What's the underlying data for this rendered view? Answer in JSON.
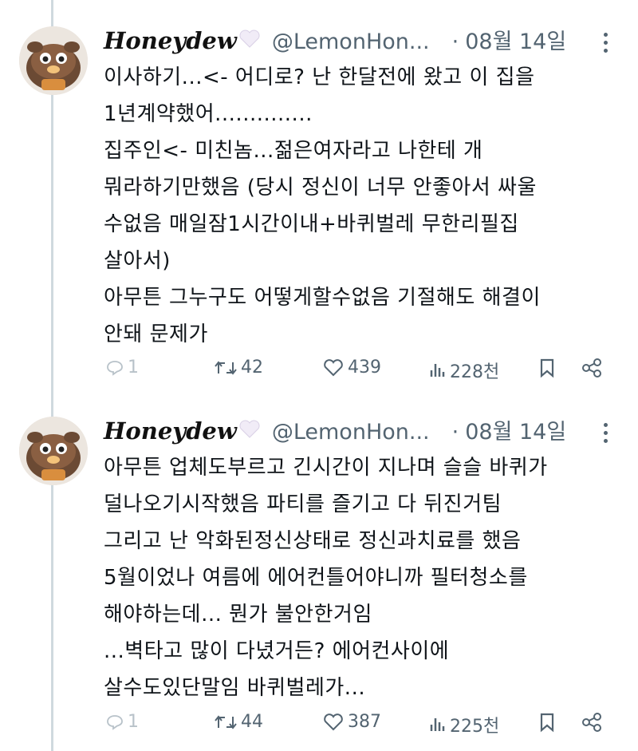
{
  "tweets": [
    {
      "author": {
        "name": "Honeydew",
        "badge_icon": "white-heart-icon",
        "handle": "@LemonHon...",
        "date": "08월 14일"
      },
      "lines": [
        "이사하기...<- 어디로? 난 한달전에 왔고 이 집을",
        "1년계약했어..............",
        "집주인<- 미친놈...젊은여자라고 나한테 개",
        "뭐라하기만했음 (당시 정신이 너무 안좋아서 싸울",
        "수없음 매일잠1시간이내+바퀴벌레 무한리필집",
        "살아서)",
        "아무튼 그누구도 어떻게할수없음 기절해도 해결이",
        "안돼 문제가"
      ],
      "stats": {
        "replies": "1",
        "retweets": "42",
        "likes": "439",
        "views": "228천"
      }
    },
    {
      "author": {
        "name": "Honeydew",
        "badge_icon": "white-heart-icon",
        "handle": "@LemonHon...",
        "date": "08월 14일"
      },
      "lines": [
        "아무튼 업체도부르고 긴시간이 지나며 슬슬 바퀴가",
        "덜나오기시작했음 파티를 즐기고 다 뒤진거팀",
        "그리고 난 악화된정신상태로 정신과치료를 했음",
        "5월이었나 여름에 에어컨틀어야니까 필터청소를",
        "해야하는데... 뭔가 불안한거임",
        "...벽타고 많이 다녔거든? 에어컨사이에",
        "살수도있단말임 바퀴벌레가..."
      ],
      "stats": {
        "replies": "1",
        "retweets": "44",
        "likes": "387",
        "views": "225천"
      }
    }
  ],
  "icons": [
    "reply-icon",
    "retweet-icon",
    "like-icon",
    "views-icon",
    "bookmark-icon",
    "share-icon",
    "more-icon"
  ]
}
